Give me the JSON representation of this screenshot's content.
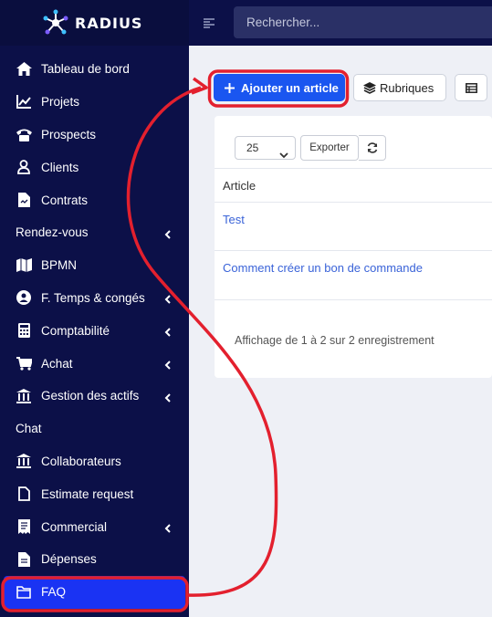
{
  "brand": {
    "name": "RADIUS"
  },
  "search": {
    "placeholder": "Rechercher..."
  },
  "sidebar": {
    "items": [
      {
        "label": "Tableau de bord",
        "icon": "home-icon"
      },
      {
        "label": "Projets",
        "icon": "chart-icon"
      },
      {
        "label": "Prospects",
        "icon": "phone-icon"
      },
      {
        "label": "Clients",
        "icon": "user-icon"
      },
      {
        "label": "Contrats",
        "icon": "file-icon"
      },
      {
        "label": "Rendez-vous",
        "section": true,
        "chevron": true
      },
      {
        "label": "BPMN",
        "icon": "map-icon"
      },
      {
        "label": "F. Temps & congés",
        "icon": "user-circle-icon",
        "chevron": true
      },
      {
        "label": "Comptabilité",
        "icon": "calculator-icon",
        "chevron": true
      },
      {
        "label": "Achat",
        "icon": "cart-icon",
        "chevron": true
      },
      {
        "label": "Gestion des actifs",
        "icon": "bank-icon",
        "chevron": true
      },
      {
        "label": "Chat",
        "section": true
      },
      {
        "label": "Collaborateurs",
        "icon": "bank-icon"
      },
      {
        "label": "Estimate request",
        "icon": "file-outline-icon"
      },
      {
        "label": "Commercial",
        "icon": "receipt-icon",
        "chevron": true
      },
      {
        "label": "Dépenses",
        "icon": "file-icon"
      },
      {
        "label": "FAQ",
        "icon": "folder-icon",
        "active": true
      }
    ]
  },
  "toolbar": {
    "add_label": "Ajouter un article",
    "rubriques_label": "Rubriques"
  },
  "table": {
    "page_size": "25",
    "export_label": "Exporter",
    "header": "Article",
    "rows": [
      "Test",
      "Comment créer un bon de commande"
    ],
    "info": "Affichage de 1 à 2 sur 2 enregistrement"
  },
  "colors": {
    "sidebar_bg": "#0c1048",
    "accent": "#1a56f0",
    "active_item": "#1a33f3",
    "annotation": "#e3202e",
    "link": "#3a63d8"
  }
}
